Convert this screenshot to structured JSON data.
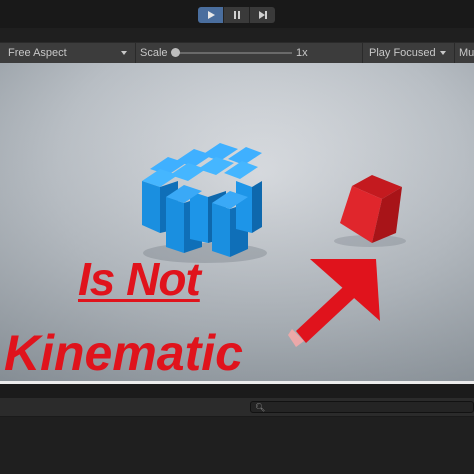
{
  "toolbar": {
    "play_icon": "play-icon",
    "pause_icon": "pause-icon",
    "step_icon": "step-icon"
  },
  "game_view": {
    "aspect": "Free Aspect",
    "scale_label": "Scale",
    "scale_value": "1x",
    "scale_level": 0.0,
    "play_mode": "Play Focused",
    "mute_label": "Mu"
  },
  "thumbnail": {
    "line1": "Is Not",
    "line2": "Kinematic",
    "accent_color": "#e0131c",
    "cube_color": "#1a8fe0"
  },
  "console": {
    "search_icon": "search-icon",
    "search_value": ""
  }
}
